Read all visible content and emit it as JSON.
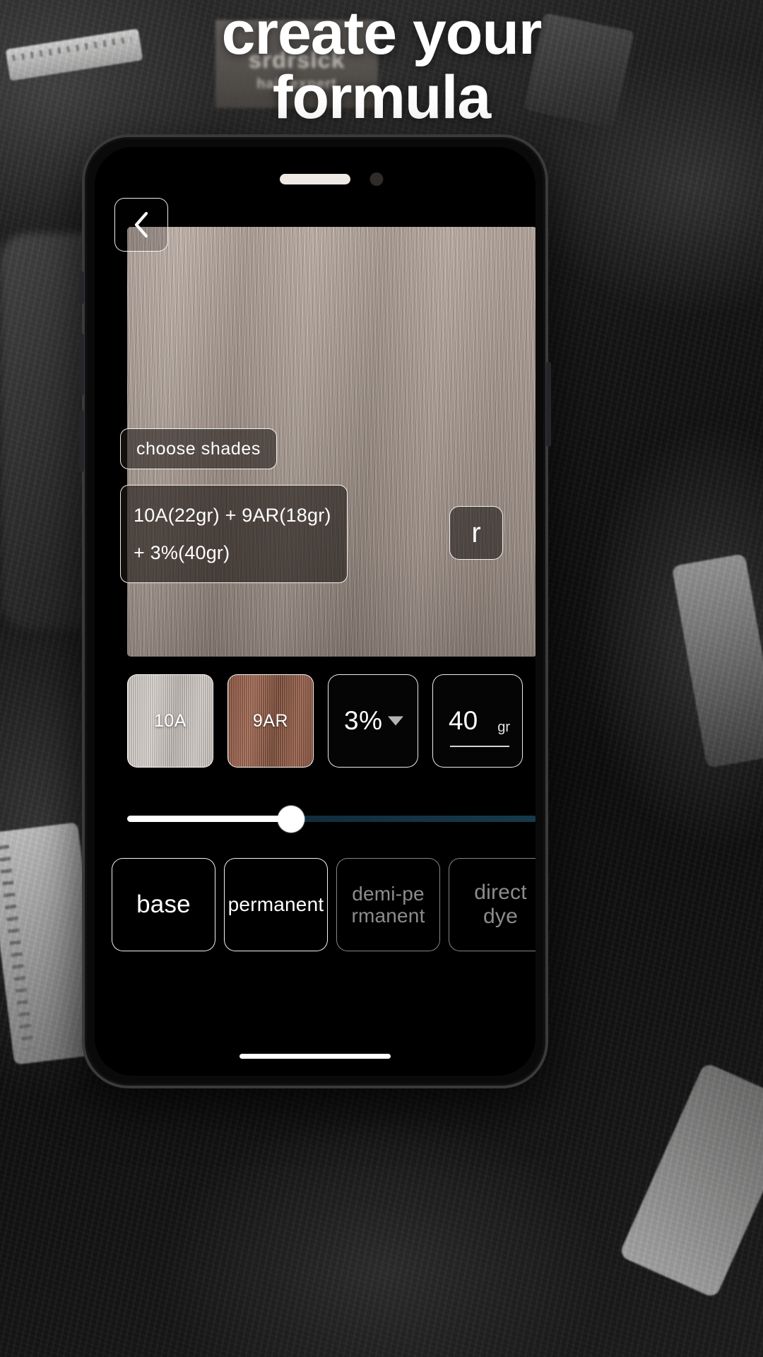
{
  "headline": {
    "line1": "create your",
    "line2": "formula"
  },
  "background": {
    "card_brand": "srdrslck",
    "card_tagline": "hair expert"
  },
  "phone": {
    "screen": {
      "back_button_icon": "chevron-left-icon",
      "preview": {
        "choose_shades_label": "choose  shades",
        "formula_text": "10A(22gr) + 9AR(18gr) + 3%(40gr)",
        "reset_button_label": "r"
      },
      "controls": {
        "shades": [
          {
            "code": "10A",
            "color": "#cbc5bf"
          },
          {
            "code": "9AR",
            "color": "#915943"
          }
        ],
        "developer": {
          "value": "3%",
          "caret_icon": "chevron-down-icon"
        },
        "grams": {
          "value": "40",
          "unit": "gr"
        }
      },
      "slider": {
        "value_percent": 40
      },
      "types": [
        {
          "label": "base",
          "state": "active"
        },
        {
          "label": "permanent",
          "state": "active"
        },
        {
          "label": "demi-pe\nrmanent",
          "state": "dim"
        },
        {
          "label": "direct\ndye",
          "state": "dim"
        }
      ]
    }
  },
  "colors": {
    "accent_white": "#ffffff",
    "screen_black": "#000000",
    "slider_track": "#16394c",
    "dim_text": "#8e8c8a"
  }
}
